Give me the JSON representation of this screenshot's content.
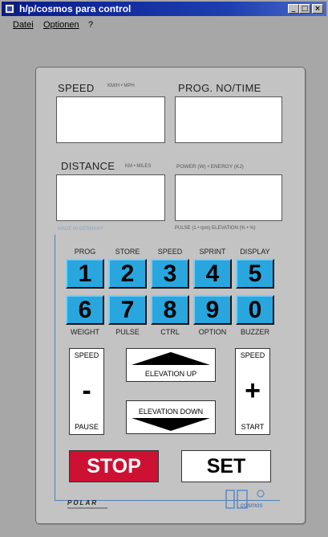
{
  "window": {
    "title": "h/p/cosmos para control",
    "buttons": {
      "minimize": "_",
      "maximize": "□",
      "close": "×"
    }
  },
  "menu": [
    {
      "label": "Datei"
    },
    {
      "label": "Optionen"
    },
    {
      "label": "?"
    }
  ],
  "displays": {
    "speed_label": "SPEED",
    "speed_units": "KM/H • MPH",
    "prog_label": "PROG. NO/TIME",
    "distance_label": "DISTANCE",
    "distance_units": "KM • MILES",
    "power_label": "POWER (W) • ENERGY (KJ)",
    "pulse_label": "PULSE (1 • rpm) ELEVATION (% • %)",
    "made_in": "MADE IN GERMANY"
  },
  "keypad": {
    "top_labels": [
      "PROG",
      "STORE",
      "SPEED",
      "SPRINT",
      "DISPLAY"
    ],
    "row1": [
      "1",
      "2",
      "3",
      "4",
      "5"
    ],
    "row2": [
      "6",
      "7",
      "8",
      "9",
      "0"
    ],
    "bottom_labels": [
      "WEIGHT",
      "PULSE",
      "CTRL",
      "OPTION",
      "BUZZER"
    ]
  },
  "controls": {
    "speed_minus": {
      "top": "SPEED",
      "symbol": "-",
      "bottom": "PAUSE"
    },
    "speed_plus": {
      "top": "SPEED",
      "symbol": "+",
      "bottom": "START"
    },
    "elevation_up": "ELEVATION   UP",
    "elevation_down": "ELEVATION   DOWN",
    "stop": "STOP",
    "set": "SET"
  },
  "branding": {
    "polar": "POLAR",
    "cosmos": "cosmos"
  },
  "colors": {
    "key_blue": "#29a6de",
    "stop_red": "#cc1133",
    "titlebar": "#0a1a8a",
    "frame_line": "#4f7fb8"
  }
}
